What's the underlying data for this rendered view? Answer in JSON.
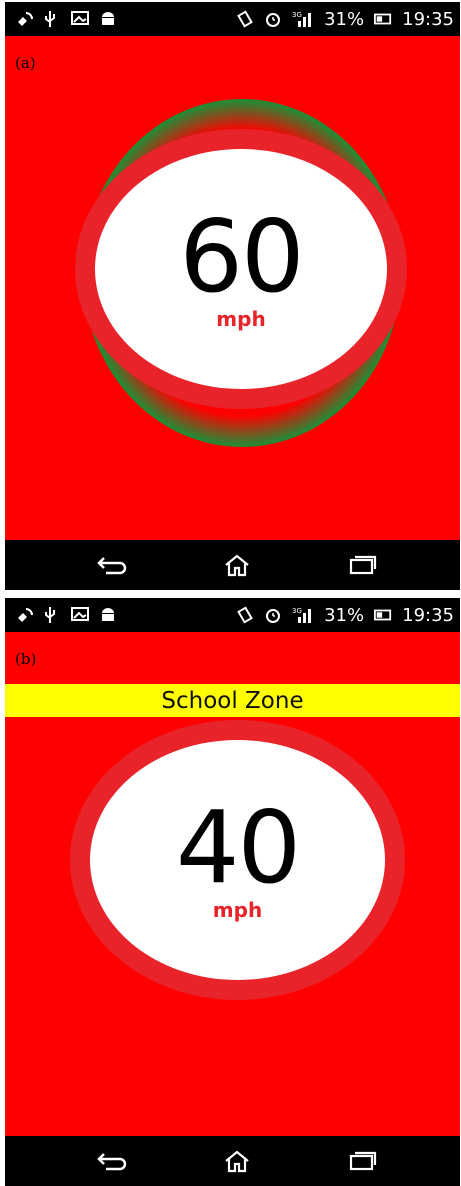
{
  "panels": [
    {
      "label": "(a)",
      "status": {
        "battery": "31%",
        "time": "19:35",
        "network": "3G"
      },
      "speed": {
        "value": "60",
        "unit": "mph"
      }
    },
    {
      "label": "(b)",
      "status": {
        "battery": "31%",
        "time": "19:35",
        "network": "3G"
      },
      "zone": "School Zone",
      "speed": {
        "value": "40",
        "unit": "mph"
      }
    }
  ],
  "colors": {
    "background": "#ff0000",
    "ring": "#e8232a",
    "halo": "#1b9137",
    "banner": "#ffff00",
    "bars": "#000000"
  },
  "icons": [
    "satellite-icon",
    "usb-icon",
    "image-icon",
    "android-icon",
    "vibrate-icon",
    "alarm-icon",
    "signal-icon",
    "battery-icon",
    "back-icon",
    "home-icon",
    "recent-apps-icon"
  ]
}
